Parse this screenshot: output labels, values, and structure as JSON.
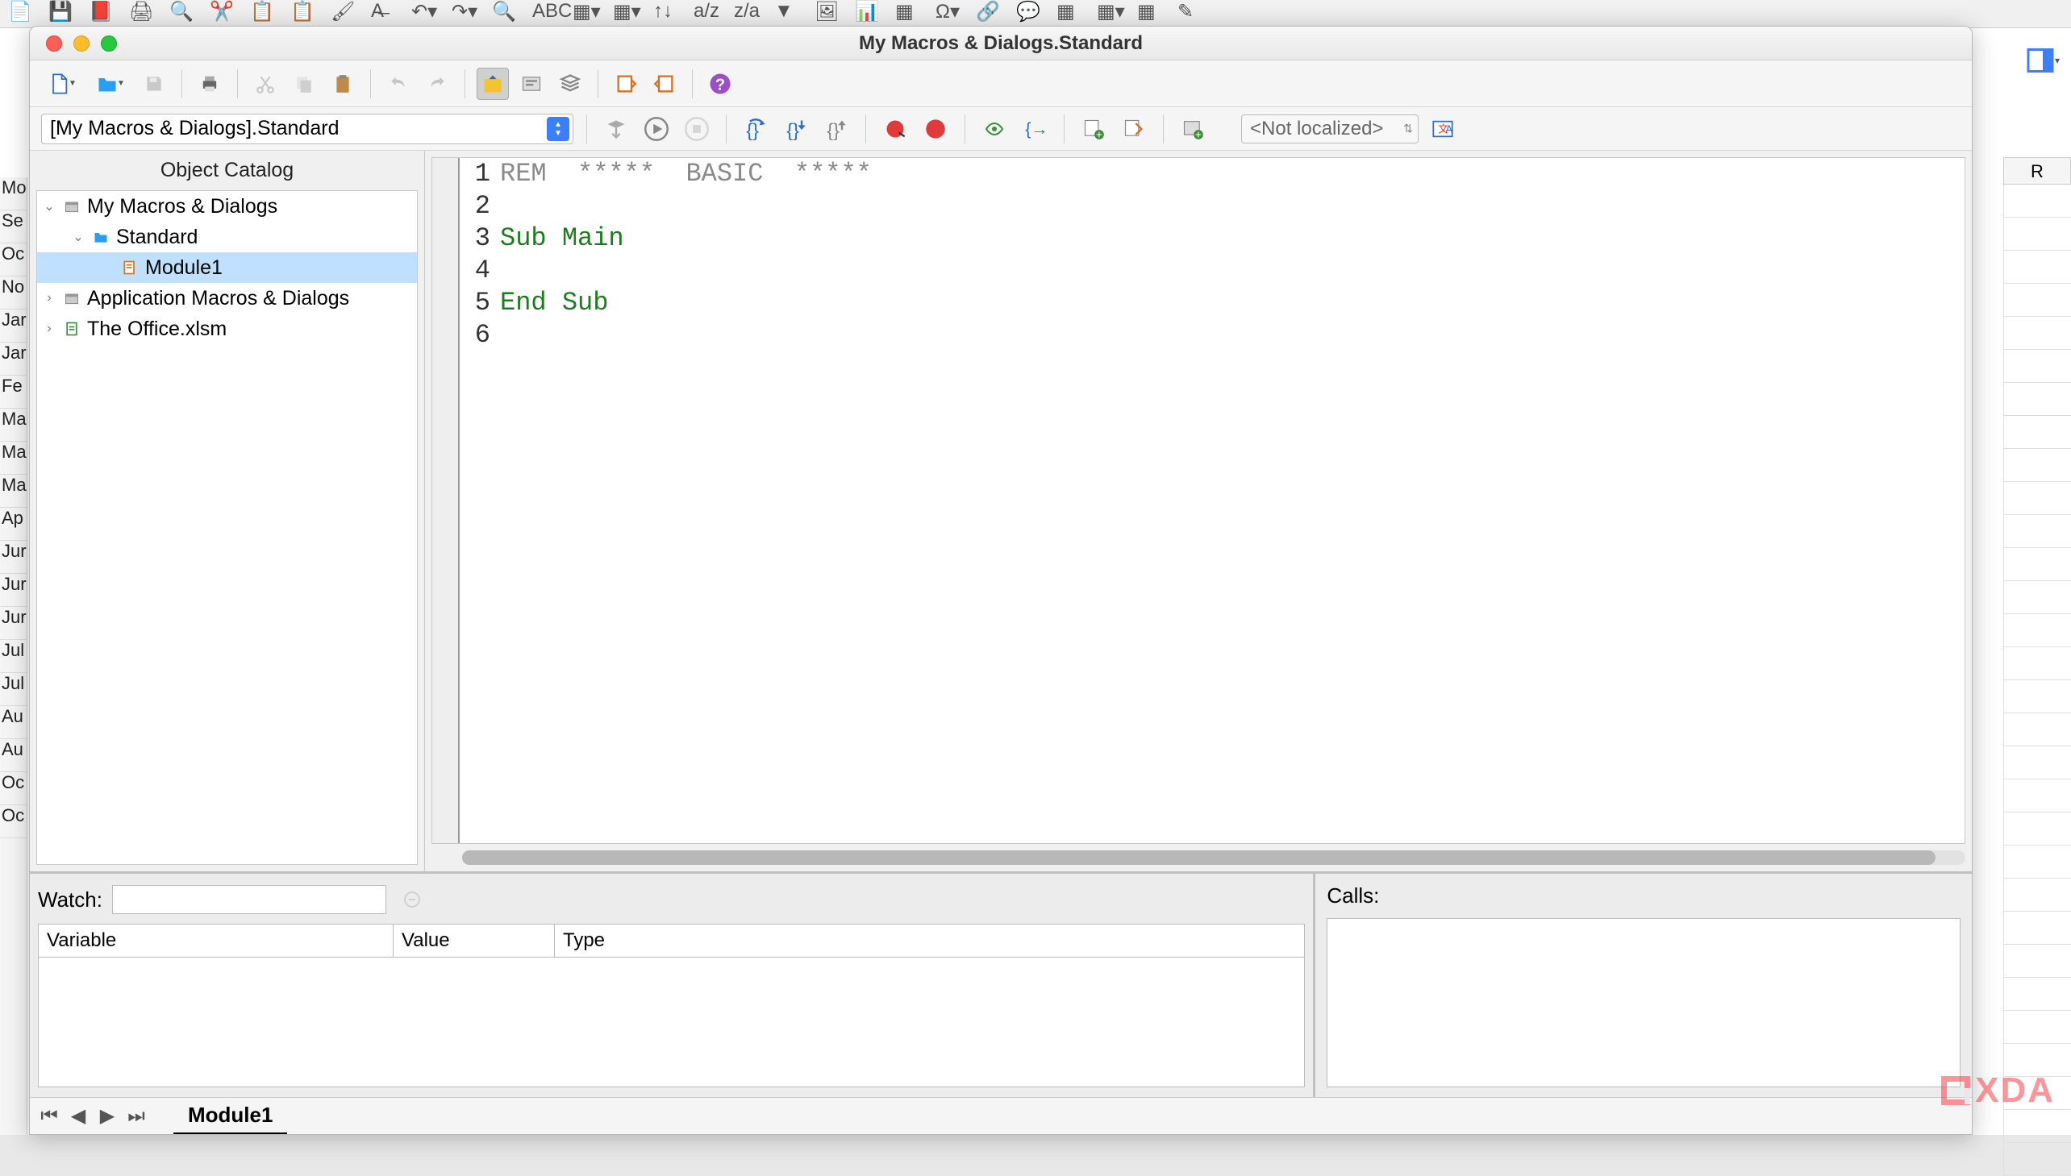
{
  "window": {
    "title": "My Macros & Dialogs.Standard"
  },
  "bg": {
    "col_header": "R",
    "row_labels": [
      "Mo",
      "Se",
      "Oc",
      "No",
      "Jar",
      "Jar",
      "Fe",
      "Ma",
      "Ma",
      "Ma",
      "Ap",
      "Jur",
      "Jur",
      "Jur",
      "Jul",
      "Jul",
      "Au",
      "Au",
      "Oc",
      "Oc"
    ]
  },
  "toolbar2": {
    "library_path": "[My Macros & Dialogs].Standard",
    "localized_label": "<Not localized>"
  },
  "catalog": {
    "header": "Object Catalog",
    "items": [
      {
        "label": "My Macros & Dialogs",
        "depth": 0,
        "expanded": true,
        "icon": "lib"
      },
      {
        "label": "Standard",
        "depth": 1,
        "expanded": true,
        "icon": "folder"
      },
      {
        "label": "Module1",
        "depth": 2,
        "selected": true,
        "icon": "module"
      },
      {
        "label": "Application Macros & Dialogs",
        "depth": 0,
        "collapsed": true,
        "icon": "lib"
      },
      {
        "label": "The Office.xlsm",
        "depth": 0,
        "collapsed": true,
        "icon": "doc"
      }
    ]
  },
  "code": {
    "lines": [
      {
        "n": 1,
        "tokens": [
          {
            "t": "REM  *****  BASIC  *****",
            "c": "comment"
          }
        ]
      },
      {
        "n": 2,
        "tokens": []
      },
      {
        "n": 3,
        "tokens": [
          {
            "t": "Sub ",
            "c": "keyword"
          },
          {
            "t": "Main",
            "c": "ident"
          }
        ]
      },
      {
        "n": 4,
        "tokens": []
      },
      {
        "n": 5,
        "tokens": [
          {
            "t": "End Sub",
            "c": "keyword"
          }
        ]
      },
      {
        "n": 6,
        "tokens": []
      }
    ]
  },
  "watch": {
    "label": "Watch:",
    "columns": [
      "Variable",
      "Value",
      "Type"
    ]
  },
  "calls": {
    "label": "Calls:"
  },
  "tabs": {
    "module": "Module1"
  },
  "watermark": "XDA"
}
